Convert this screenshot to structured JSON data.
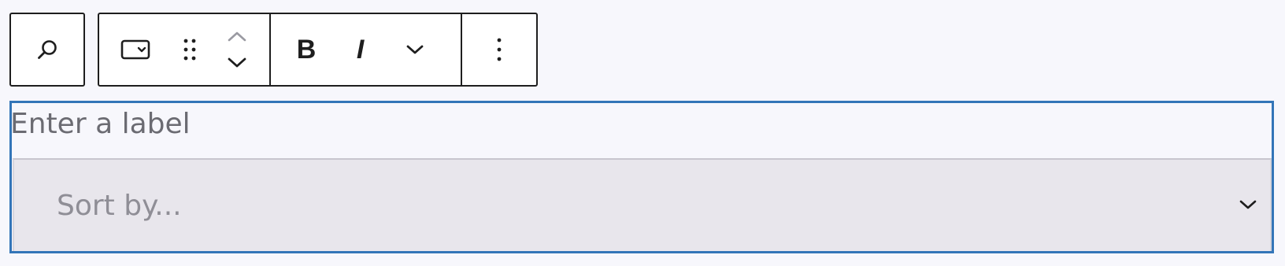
{
  "toolbar": {
    "search_icon": "search-icon",
    "block_type_icon": "select-block-icon",
    "drag_icon": "drag-handle-icon",
    "move_up_icon": "chevron-up-icon",
    "move_down_icon": "chevron-down-icon",
    "bold_label": "B",
    "italic_label": "I",
    "more_formats_icon": "chevron-down-icon",
    "options_icon": "more-vertical-icon"
  },
  "block": {
    "label_placeholder": "Enter a label",
    "select_placeholder": "Sort by...",
    "select_icon": "chevron-down-icon",
    "accent_color": "#3375b8"
  }
}
